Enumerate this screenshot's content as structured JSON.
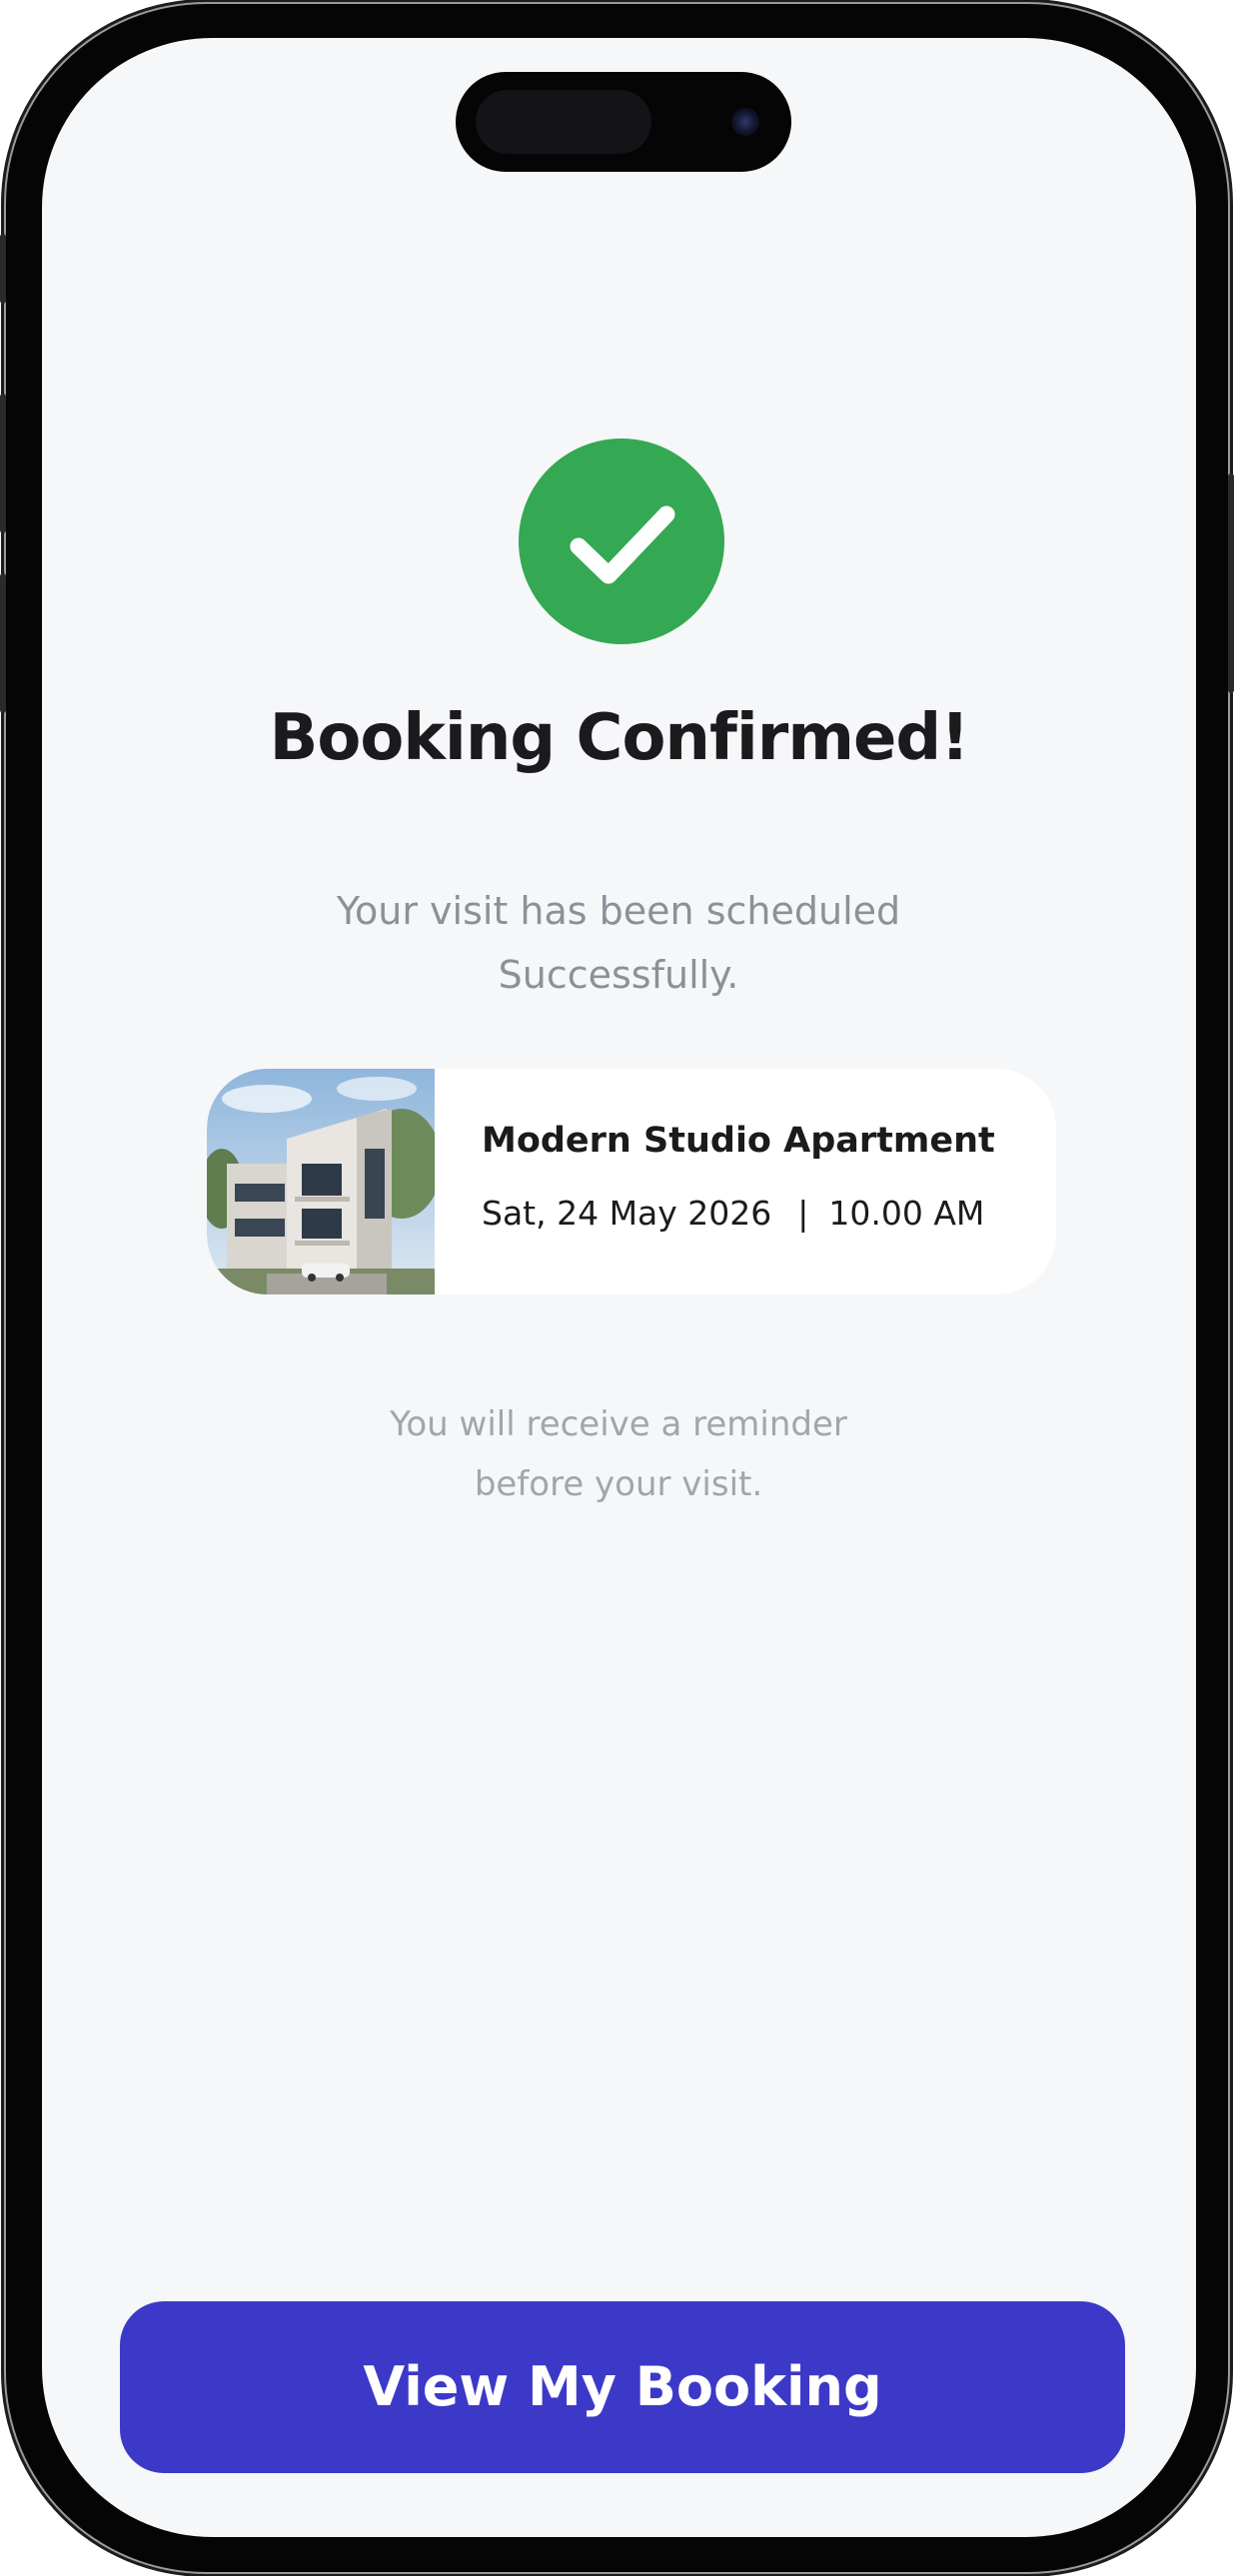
{
  "confirmation": {
    "title": "Booking Confirmed!",
    "subtitle_line1": "Your visit has been scheduled",
    "subtitle_line2": "Successfully.",
    "status_color": "#34a853",
    "icon": "check-icon"
  },
  "booking_card": {
    "image": "modern-townhouse-photo",
    "property_name": "Modern Studio Apartment",
    "date": "Sat, 24 May 2026",
    "separator": "|",
    "time": "10.00 AM"
  },
  "reminder": {
    "line1": "You will receive a reminder",
    "line2": "before your visit."
  },
  "actions": {
    "view_booking_label": "View My Booking",
    "button_color": "#3c39c8"
  }
}
